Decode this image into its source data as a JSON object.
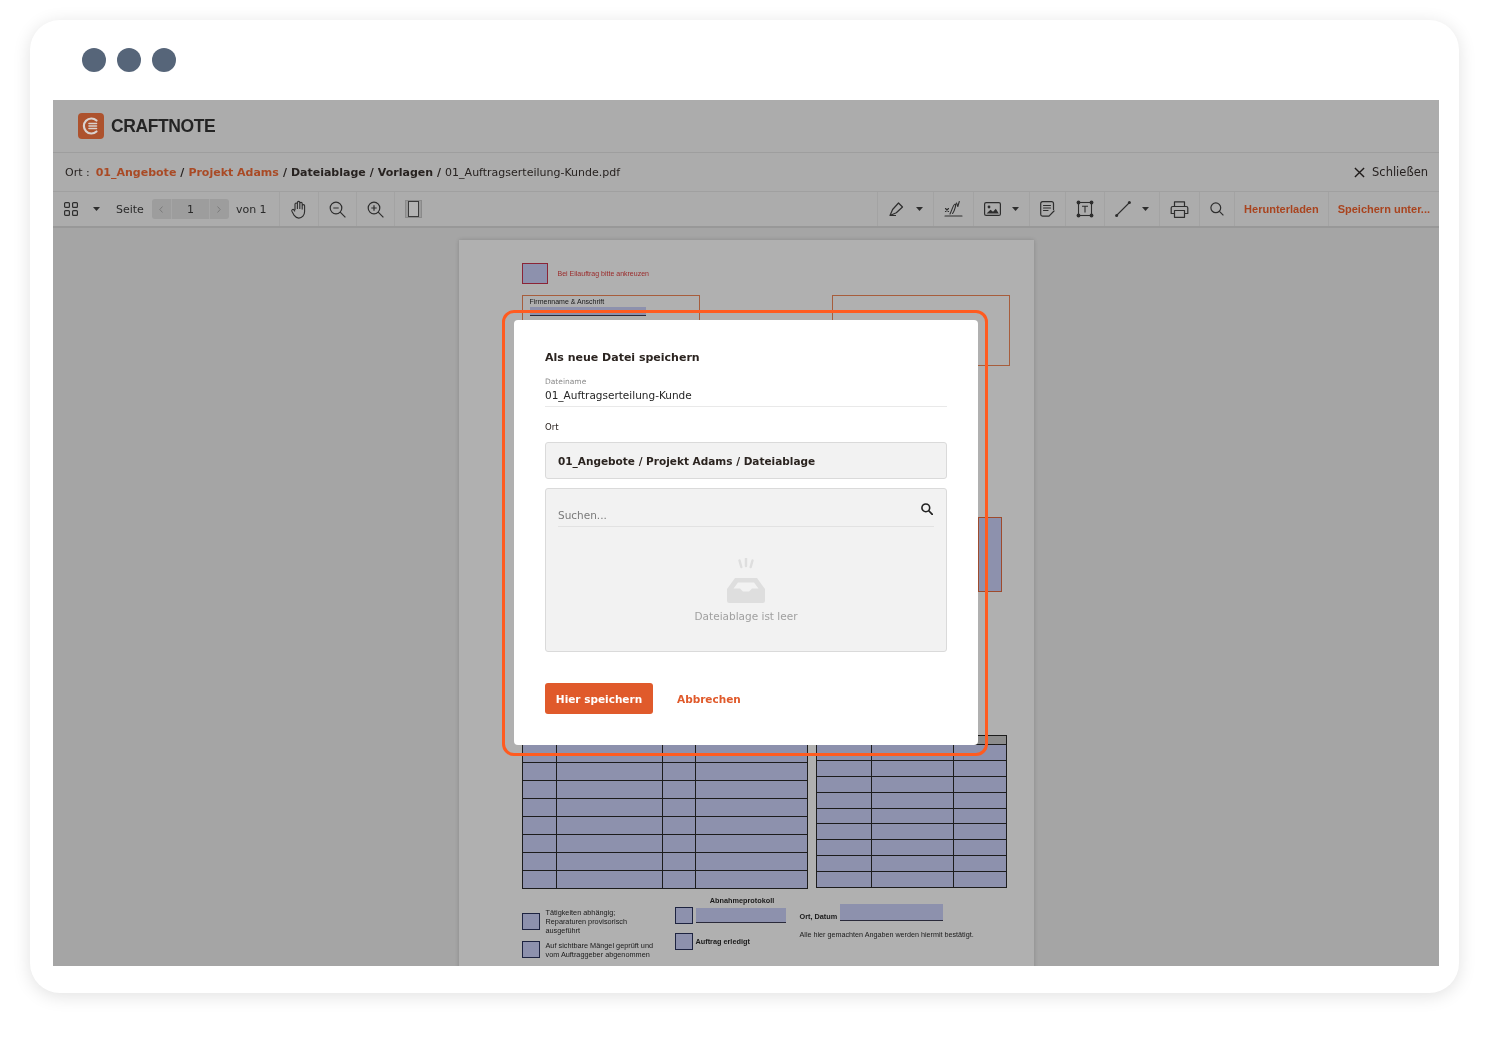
{
  "header": {
    "logo_text": "CRAFTNOTE"
  },
  "breadcrumb": {
    "label": "Ort :",
    "items": [
      {
        "kind": "link",
        "text": "01_Angebote"
      },
      {
        "kind": "separator",
        "text": "/"
      },
      {
        "kind": "link",
        "text": "Projekt Adams"
      },
      {
        "kind": "separator",
        "text": "/"
      },
      {
        "kind": "folder",
        "text": "Dateiablage"
      },
      {
        "kind": "separator",
        "text": "/"
      },
      {
        "kind": "folder",
        "text": "Vorlagen"
      },
      {
        "kind": "separator",
        "text": "/"
      },
      {
        "kind": "file",
        "text": "01_Auftragserteilung-Kunde.pdf"
      }
    ],
    "close": {
      "label": "Schließen"
    }
  },
  "toolbar": {
    "page_label": "Seite",
    "page_number": "1",
    "page_count": "von 1",
    "actions": [
      {
        "label": "Herunterladen"
      },
      {
        "label": "Speichern unter..."
      }
    ]
  },
  "document": {
    "rush_order": {
      "label": "Bei Eilauftrag bitte ankreuzen",
      "checked": false
    },
    "address_box": {
      "label": "Firmenname & Anschrift"
    },
    "acceptance": {
      "title": "Abnahmeprotokoll",
      "left_items": [
        {
          "label": "Tätigkeiten abhängig; Reparaturen provisorisch ausgeführt",
          "checked": false
        },
        {
          "label": "Auf sichtbare Mängel geprüft und vom Auftraggeber abgenommen",
          "checked": false
        }
      ],
      "middle_items": [
        {
          "kind": "field",
          "checked": false
        },
        {
          "kind": "label",
          "label": "Auftrag erledigt",
          "checked": false
        }
      ],
      "place_date": {
        "label": "Ort, Datum"
      },
      "confirmation": "Alle hier gemachten Angaben werden hiermit bestätigt."
    }
  },
  "dialog": {
    "title": "Als neue Datei speichern",
    "filename": {
      "label": "Dateiname",
      "value": "01_Auftragserteilung-Kunde"
    },
    "location": {
      "label": "Ort",
      "path": "01_Angebote / Projekt Adams / Dateiablage"
    },
    "search": {
      "placeholder": "Suchen..."
    },
    "empty_text": "Dateiablage ist leer",
    "buttons": [
      {
        "kind": "primary",
        "label": "Hier speichern"
      },
      {
        "kind": "link",
        "label": "Abbrechen"
      }
    ]
  }
}
